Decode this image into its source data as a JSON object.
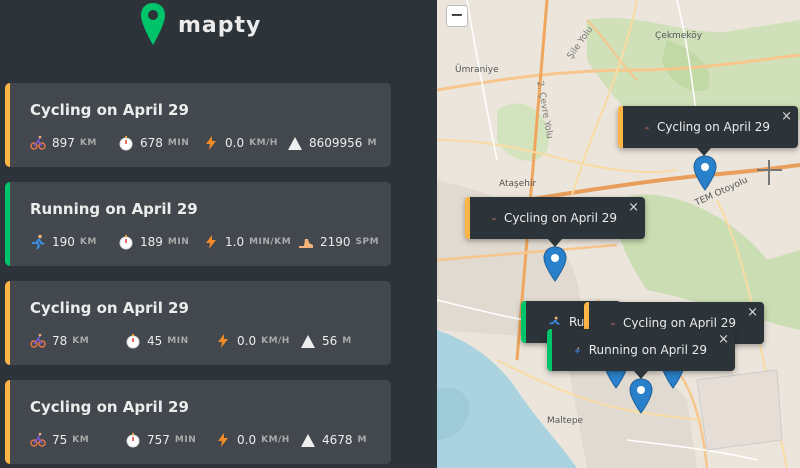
{
  "app": {
    "name": "mapty"
  },
  "colors": {
    "cycling": "#ffb545",
    "running": "#00c46a",
    "marker": "#2a81cb"
  },
  "workouts": [
    {
      "title": "Cycling on April 29",
      "type": "cycling",
      "stats": [
        {
          "icon": "cyclist-icon",
          "value": "897",
          "unit": "KM"
        },
        {
          "icon": "stopwatch-icon",
          "value": "678",
          "unit": "MIN"
        },
        {
          "icon": "lightning-icon",
          "value": "0.0",
          "unit": "KM/H"
        },
        {
          "icon": "mountain-icon",
          "value": "8609956",
          "unit": "M"
        }
      ]
    },
    {
      "title": "Running on April 29",
      "type": "running",
      "stats": [
        {
          "icon": "runner-icon",
          "value": "190",
          "unit": "KM"
        },
        {
          "icon": "stopwatch-icon",
          "value": "189",
          "unit": "MIN"
        },
        {
          "icon": "lightning-icon",
          "value": "1.0",
          "unit": "MIN/KM"
        },
        {
          "icon": "footprint-icon",
          "value": "2190",
          "unit": "SPM"
        }
      ]
    },
    {
      "title": "Cycling on April 29",
      "type": "cycling",
      "stats": [
        {
          "icon": "cyclist-icon",
          "value": "78",
          "unit": "KM"
        },
        {
          "icon": "stopwatch-icon",
          "value": "45",
          "unit": "MIN"
        },
        {
          "icon": "lightning-icon",
          "value": "0.0",
          "unit": "KM/H"
        },
        {
          "icon": "mountain-icon",
          "value": "56",
          "unit": "M"
        }
      ]
    },
    {
      "title": "Cycling on April 29",
      "type": "cycling",
      "stats": [
        {
          "icon": "cyclist-icon",
          "value": "75",
          "unit": "KM"
        },
        {
          "icon": "stopwatch-icon",
          "value": "757",
          "unit": "MIN"
        },
        {
          "icon": "lightning-icon",
          "value": "0.0",
          "unit": "KM/H"
        },
        {
          "icon": "mountain-icon",
          "value": "4678",
          "unit": "M"
        }
      ]
    }
  ],
  "map": {
    "zoom_out_label": "−",
    "labels": [
      "Çekmeköy",
      "Şile Yolu",
      "Ümraniye",
      "2. Çevre Yolu",
      "Ataşehir",
      "TEM Otoyolu",
      "Maltepe"
    ],
    "popups": [
      {
        "text": "Cycling on April 29",
        "type": "cycling",
        "close": "×"
      },
      {
        "text": "Cycling on April 29",
        "type": "cycling",
        "close": "×"
      },
      {
        "text": "Ru",
        "type": "running",
        "close": ""
      },
      {
        "text": "Cycling on April 29",
        "type": "cycling",
        "close": "×"
      },
      {
        "text": "Running on April 29",
        "type": "running",
        "close": "×"
      }
    ]
  }
}
